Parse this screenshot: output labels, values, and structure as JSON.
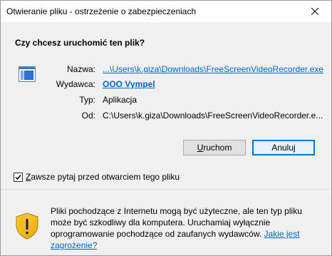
{
  "window": {
    "title": "Otwieranie pliku - ostrzeżenie o zabezpieczeniach"
  },
  "dialog": {
    "question": "Czy chcesz uruchomić ten plik?",
    "fields": {
      "name_label": "Nazwa:",
      "name_value": "...\\Users\\k.giza\\Downloads\\FreeScreenVideoRecorder.exe",
      "publisher_label": "Wydawca:",
      "publisher_value": "OOO Vympel",
      "type_label": "Typ:",
      "type_value": "Aplikacja",
      "from_label": "Od:",
      "from_value": "C:\\Users\\k.giza\\Downloads\\FreeScreenVideoRecorder.e..."
    },
    "buttons": {
      "run_underlined": "U",
      "run_rest": "ruchom",
      "cancel_label": "Anuluj"
    },
    "checkbox": {
      "underlined": "Z",
      "rest": "awsze pytaj przed otwarciem tego pliku",
      "checked": true
    },
    "warning": {
      "text": "Pliki pochodzące z Internetu mogą być użyteczne, ale ten typ pliku może być szkodliwy dla komputera. Uruchamiaj wyłącznie oprogramowanie pochodzące od zaufanych wydawców. ",
      "link": "Jakie jest zagrożenie?"
    }
  },
  "icons": {
    "close": "close-icon",
    "file": "application-file-icon",
    "shield": "security-shield-icon",
    "checkmark": "checkmark-icon"
  },
  "colors": {
    "link": "#0066cc",
    "default_button_border": "#0078d7",
    "background": "#f0f0f0"
  }
}
